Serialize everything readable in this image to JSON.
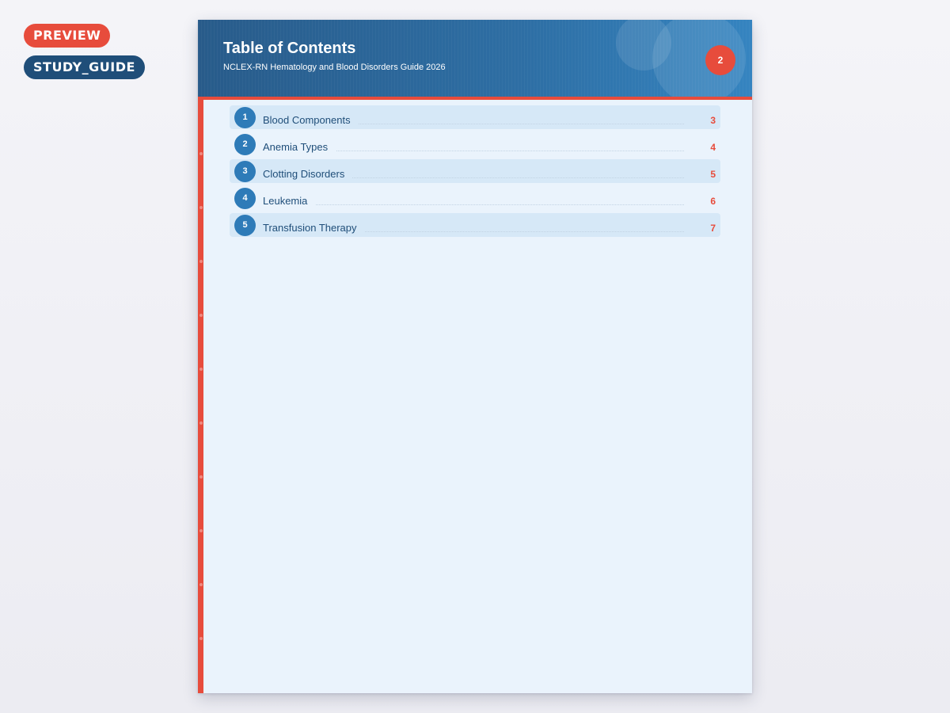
{
  "tags": {
    "preview": "PREVIEW",
    "study_guide": "STUDY_GUIDE"
  },
  "page": {
    "title": "Table of Contents",
    "subtitle": "NCLEX-RN Hematology and Blood Disorders Guide 2026",
    "page_number": "2"
  },
  "toc": [
    {
      "num": "1",
      "label": "Blood Components",
      "page": "3"
    },
    {
      "num": "2",
      "label": "Anemia Types",
      "page": "4"
    },
    {
      "num": "3",
      "label": "Clotting Disorders",
      "page": "5"
    },
    {
      "num": "4",
      "label": "Leukemia",
      "page": "6"
    },
    {
      "num": "5",
      "label": "Transfusion Therapy",
      "page": "7"
    }
  ],
  "colors": {
    "accent": "#e74c3c",
    "primary": "#2e7bb8",
    "header": "#285b8a",
    "page_bg": "#eaf3fc"
  }
}
